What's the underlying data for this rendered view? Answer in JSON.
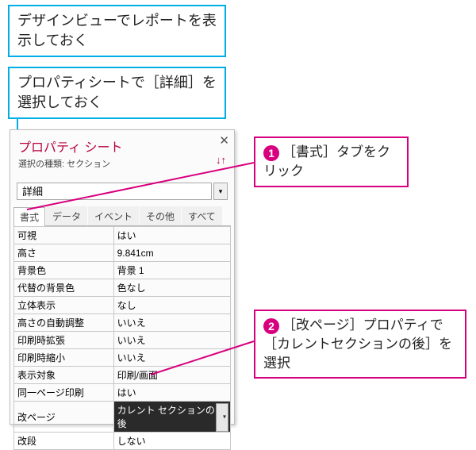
{
  "instructions": {
    "box1": "デザインビューでレポートを表示しておく",
    "box2": "プロパティシートで［詳細］を選択しておく"
  },
  "panel": {
    "title": "プロパティ シート",
    "subtitle": "選択の種類: セクション",
    "selection": "詳細",
    "tabs": [
      "書式",
      "データ",
      "イベント",
      "その他",
      "すべて"
    ],
    "active_tab": 0,
    "properties": [
      {
        "k": "可視",
        "v": "はい"
      },
      {
        "k": "高さ",
        "v": "9.841cm"
      },
      {
        "k": "背景色",
        "v": "背景 1"
      },
      {
        "k": "代替の背景色",
        "v": "色なし"
      },
      {
        "k": "立体表示",
        "v": "なし"
      },
      {
        "k": "高さの自動調整",
        "v": "いいえ"
      },
      {
        "k": "印刷時拡張",
        "v": "いいえ"
      },
      {
        "k": "印刷時縮小",
        "v": "いいえ"
      },
      {
        "k": "表示対象",
        "v": "印刷/画面"
      },
      {
        "k": "同一ページ印刷",
        "v": "はい"
      },
      {
        "k": "改ページ",
        "v": "カレント セクションの後",
        "selected": true
      },
      {
        "k": "改段",
        "v": "しない"
      }
    ]
  },
  "callouts": {
    "c1_num": "1",
    "c1_text": "［書式］タブをクリック",
    "c2_num": "2",
    "c2_text": "［改ページ］プロパティで［カレントセクションの後］を選択"
  }
}
